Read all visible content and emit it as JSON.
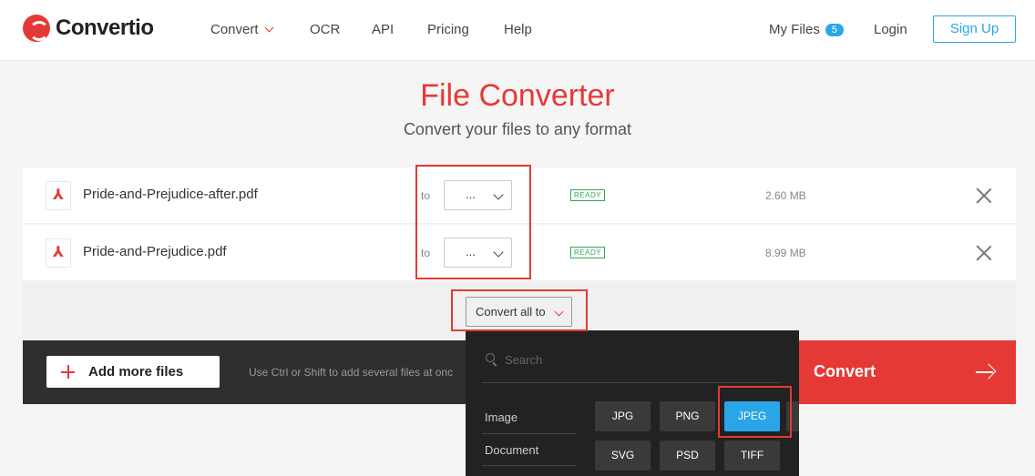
{
  "header": {
    "brand": "Convertio",
    "nav": [
      "Convert",
      "OCR",
      "API",
      "Pricing",
      "Help"
    ],
    "my_files_label": "My Files",
    "my_files_count": "5",
    "login_label": "Login",
    "signup_label": "Sign Up"
  },
  "hero": {
    "title": "File Converter",
    "subtitle": "Convert your files to any format"
  },
  "files": [
    {
      "name": "Pride-and-Prejudice-after.pdf",
      "to_label": "to",
      "format": "...",
      "status": "READY",
      "size": "2.60 MB"
    },
    {
      "name": "Pride-and-Prejudice.pdf",
      "to_label": "to",
      "format": "...",
      "status": "READY",
      "size": "8.99 MB"
    }
  ],
  "convert_all_label": "Convert all to",
  "bottom_bar": {
    "add_more_label": "Add more files",
    "hint": "Use Ctrl or Shift to add several files at onc",
    "convert_label": "Convert"
  },
  "dropdown": {
    "search_placeholder": "Search",
    "categories": [
      "Image",
      "Document"
    ],
    "formats": [
      "JPG",
      "PNG",
      "JPEG",
      "SVG",
      "PSD",
      "TIFF"
    ],
    "selected": "JPEG"
  },
  "colors": {
    "brand_red": "#e53935",
    "accent_blue": "#2aa5e8",
    "ready_green": "#3aa55a"
  }
}
